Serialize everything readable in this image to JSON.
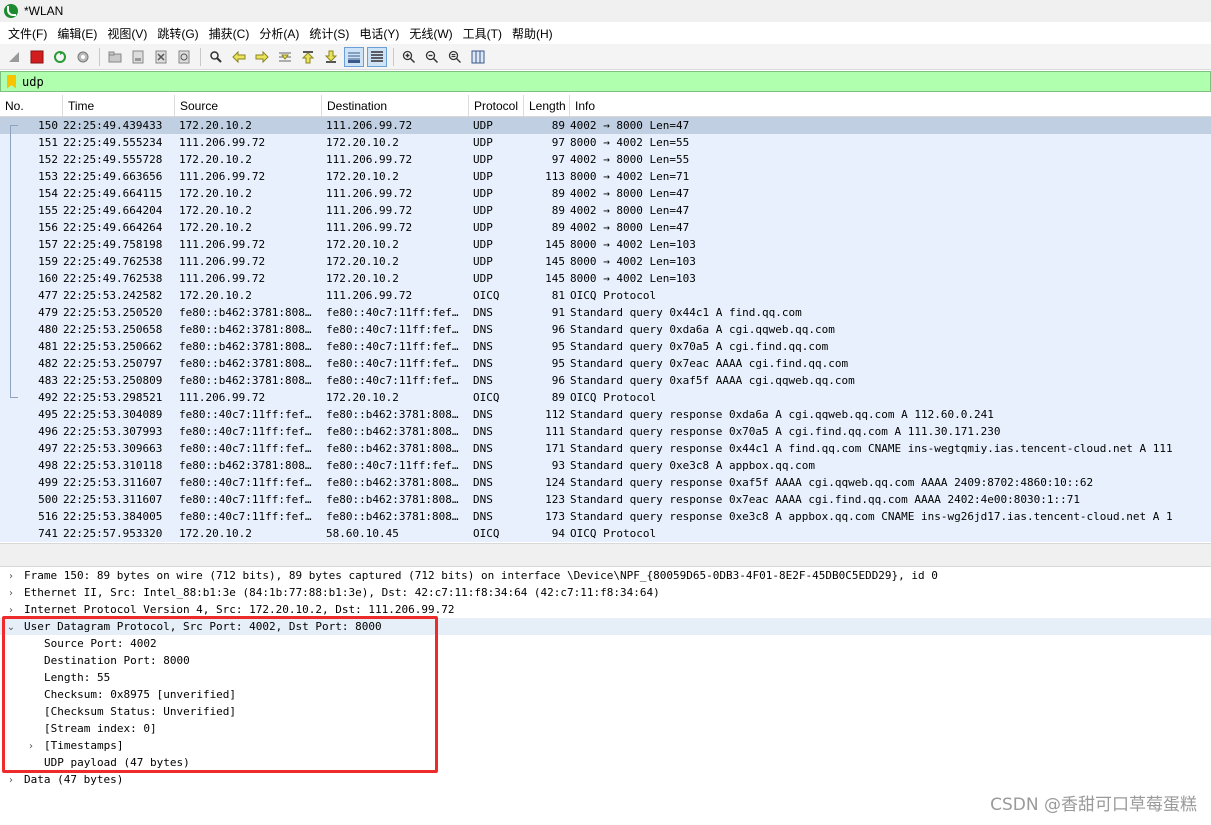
{
  "window": {
    "title": "*WLAN"
  },
  "menu": [
    "文件(F)",
    "编辑(E)",
    "视图(V)",
    "跳转(G)",
    "捕获(C)",
    "分析(A)",
    "统计(S)",
    "电话(Y)",
    "无线(W)",
    "工具(T)",
    "帮助(H)"
  ],
  "toolbar": {
    "icons": [
      "shark-fin-icon",
      "stop-icon",
      "restart-icon",
      "options-gear-icon",
      "open-folder-icon",
      "save-file-icon",
      "close-file-icon",
      "reload-icon",
      "find-icon",
      "back-arrow-icon",
      "forward-arrow-icon",
      "goto-packet-icon",
      "first-packet-icon",
      "last-packet-icon",
      "autoscroll-icon",
      "colorize-icon",
      "zoom-in-icon",
      "zoom-out-icon",
      "zoom-normal-icon",
      "resize-columns-icon"
    ]
  },
  "filter": {
    "value": "udp"
  },
  "columns": [
    "No.",
    "Time",
    "Source",
    "Destination",
    "Protocol",
    "Length",
    "Info"
  ],
  "packets": [
    {
      "no": "150",
      "time": "22:25:49.439433",
      "src": "172.20.10.2",
      "dst": "111.206.99.72",
      "proto": "UDP",
      "len": "89",
      "info": "4002 → 8000 Len=47"
    },
    {
      "no": "151",
      "time": "22:25:49.555234",
      "src": "111.206.99.72",
      "dst": "172.20.10.2",
      "proto": "UDP",
      "len": "97",
      "info": "8000 → 4002 Len=55"
    },
    {
      "no": "152",
      "time": "22:25:49.555728",
      "src": "172.20.10.2",
      "dst": "111.206.99.72",
      "proto": "UDP",
      "len": "97",
      "info": "4002 → 8000 Len=55"
    },
    {
      "no": "153",
      "time": "22:25:49.663656",
      "src": "111.206.99.72",
      "dst": "172.20.10.2",
      "proto": "UDP",
      "len": "113",
      "info": "8000 → 4002 Len=71"
    },
    {
      "no": "154",
      "time": "22:25:49.664115",
      "src": "172.20.10.2",
      "dst": "111.206.99.72",
      "proto": "UDP",
      "len": "89",
      "info": "4002 → 8000 Len=47"
    },
    {
      "no": "155",
      "time": "22:25:49.664204",
      "src": "172.20.10.2",
      "dst": "111.206.99.72",
      "proto": "UDP",
      "len": "89",
      "info": "4002 → 8000 Len=47"
    },
    {
      "no": "156",
      "time": "22:25:49.664264",
      "src": "172.20.10.2",
      "dst": "111.206.99.72",
      "proto": "UDP",
      "len": "89",
      "info": "4002 → 8000 Len=47"
    },
    {
      "no": "157",
      "time": "22:25:49.758198",
      "src": "111.206.99.72",
      "dst": "172.20.10.2",
      "proto": "UDP",
      "len": "145",
      "info": "8000 → 4002 Len=103"
    },
    {
      "no": "159",
      "time": "22:25:49.762538",
      "src": "111.206.99.72",
      "dst": "172.20.10.2",
      "proto": "UDP",
      "len": "145",
      "info": "8000 → 4002 Len=103"
    },
    {
      "no": "160",
      "time": "22:25:49.762538",
      "src": "111.206.99.72",
      "dst": "172.20.10.2",
      "proto": "UDP",
      "len": "145",
      "info": "8000 → 4002 Len=103"
    },
    {
      "no": "477",
      "time": "22:25:53.242582",
      "src": "172.20.10.2",
      "dst": "111.206.99.72",
      "proto": "OICQ",
      "len": "81",
      "info": "OICQ Protocol"
    },
    {
      "no": "479",
      "time": "22:25:53.250520",
      "src": "fe80::b462:3781:808…",
      "dst": "fe80::40c7:11ff:fef…",
      "proto": "DNS",
      "len": "91",
      "info": "Standard query 0x44c1 A find.qq.com"
    },
    {
      "no": "480",
      "time": "22:25:53.250658",
      "src": "fe80::b462:3781:808…",
      "dst": "fe80::40c7:11ff:fef…",
      "proto": "DNS",
      "len": "96",
      "info": "Standard query 0xda6a A cgi.qqweb.qq.com"
    },
    {
      "no": "481",
      "time": "22:25:53.250662",
      "src": "fe80::b462:3781:808…",
      "dst": "fe80::40c7:11ff:fef…",
      "proto": "DNS",
      "len": "95",
      "info": "Standard query 0x70a5 A cgi.find.qq.com"
    },
    {
      "no": "482",
      "time": "22:25:53.250797",
      "src": "fe80::b462:3781:808…",
      "dst": "fe80::40c7:11ff:fef…",
      "proto": "DNS",
      "len": "95",
      "info": "Standard query 0x7eac AAAA cgi.find.qq.com"
    },
    {
      "no": "483",
      "time": "22:25:53.250809",
      "src": "fe80::b462:3781:808…",
      "dst": "fe80::40c7:11ff:fef…",
      "proto": "DNS",
      "len": "96",
      "info": "Standard query 0xaf5f AAAA cgi.qqweb.qq.com"
    },
    {
      "no": "492",
      "time": "22:25:53.298521",
      "src": "111.206.99.72",
      "dst": "172.20.10.2",
      "proto": "OICQ",
      "len": "89",
      "info": "OICQ Protocol"
    },
    {
      "no": "495",
      "time": "22:25:53.304089",
      "src": "fe80::40c7:11ff:fef…",
      "dst": "fe80::b462:3781:808…",
      "proto": "DNS",
      "len": "112",
      "info": "Standard query response 0xda6a A cgi.qqweb.qq.com A 112.60.0.241"
    },
    {
      "no": "496",
      "time": "22:25:53.307993",
      "src": "fe80::40c7:11ff:fef…",
      "dst": "fe80::b462:3781:808…",
      "proto": "DNS",
      "len": "111",
      "info": "Standard query response 0x70a5 A cgi.find.qq.com A 111.30.171.230"
    },
    {
      "no": "497",
      "time": "22:25:53.309663",
      "src": "fe80::40c7:11ff:fef…",
      "dst": "fe80::b462:3781:808…",
      "proto": "DNS",
      "len": "171",
      "info": "Standard query response 0x44c1 A find.qq.com CNAME ins-wegtqmiy.ias.tencent-cloud.net A 111"
    },
    {
      "no": "498",
      "time": "22:25:53.310118",
      "src": "fe80::b462:3781:808…",
      "dst": "fe80::40c7:11ff:fef…",
      "proto": "DNS",
      "len": "93",
      "info": "Standard query 0xe3c8 A appbox.qq.com"
    },
    {
      "no": "499",
      "time": "22:25:53.311607",
      "src": "fe80::40c7:11ff:fef…",
      "dst": "fe80::b462:3781:808…",
      "proto": "DNS",
      "len": "124",
      "info": "Standard query response 0xaf5f AAAA cgi.qqweb.qq.com AAAA 2409:8702:4860:10::62"
    },
    {
      "no": "500",
      "time": "22:25:53.311607",
      "src": "fe80::40c7:11ff:fef…",
      "dst": "fe80::b462:3781:808…",
      "proto": "DNS",
      "len": "123",
      "info": "Standard query response 0x7eac AAAA cgi.find.qq.com AAAA 2402:4e00:8030:1::71"
    },
    {
      "no": "516",
      "time": "22:25:53.384005",
      "src": "fe80::40c7:11ff:fef…",
      "dst": "fe80::b462:3781:808…",
      "proto": "DNS",
      "len": "173",
      "info": "Standard query response 0xe3c8 A appbox.qq.com CNAME ins-wg26jd17.ias.tencent-cloud.net A 1"
    },
    {
      "no": "741",
      "time": "22:25:57.953320",
      "src": "172.20.10.2",
      "dst": "58.60.10.45",
      "proto": "OICQ",
      "len": "94",
      "info": "OICQ Protocol"
    }
  ],
  "details": [
    {
      "arrow": "›",
      "level": 0,
      "text": "Frame 150: 89 bytes on wire (712 bits), 89 bytes captured (712 bits) on interface \\Device\\NPF_{80059D65-0DB3-4F01-8E2F-45DB0C5EDD29}, id 0"
    },
    {
      "arrow": "›",
      "level": 0,
      "text": "Ethernet II, Src: Intel_88:b1:3e (84:1b:77:88:b1:3e), Dst: 42:c7:11:f8:34:64 (42:c7:11:f8:34:64)"
    },
    {
      "arrow": "›",
      "level": 0,
      "text": "Internet Protocol Version 4, Src: 172.20.10.2, Dst: 111.206.99.72"
    },
    {
      "arrow": "⌄",
      "level": 0,
      "text": "User Datagram Protocol, Src Port: 4002, Dst Port: 8000"
    },
    {
      "arrow": "",
      "level": 1,
      "text": "Source Port: 4002"
    },
    {
      "arrow": "",
      "level": 1,
      "text": "Destination Port: 8000"
    },
    {
      "arrow": "",
      "level": 1,
      "text": "Length: 55"
    },
    {
      "arrow": "",
      "level": 1,
      "text": "Checksum: 0x8975 [unverified]"
    },
    {
      "arrow": "",
      "level": 1,
      "text": "[Checksum Status: Unverified]"
    },
    {
      "arrow": "",
      "level": 1,
      "text": "[Stream index: 0]"
    },
    {
      "arrow": "›",
      "level": 1,
      "text": "[Timestamps]"
    },
    {
      "arrow": "",
      "level": 1,
      "text": "UDP payload (47 bytes)"
    },
    {
      "arrow": "›",
      "level": 0,
      "text": "Data (47 bytes)"
    }
  ],
  "watermark": "CSDN @香甜可口草莓蛋糕",
  "colors": {
    "filter_valid": "#afffaf",
    "row_bg": "#e7f0fc",
    "row_selected": "#c0d0e2",
    "highlight_box": "#ee2b2b"
  }
}
